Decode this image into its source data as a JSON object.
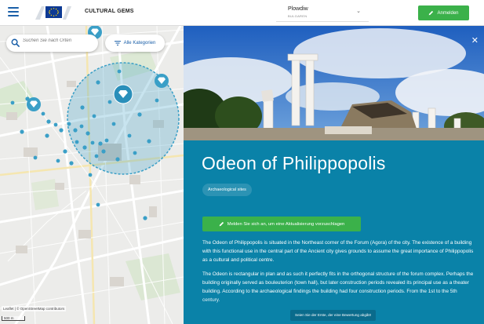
{
  "header": {
    "app_title": "CULTURAL GEMS",
    "city": {
      "name": "Plowdiw",
      "country": "BULGAREN"
    },
    "login_label": "Anmelden",
    "icons": {
      "menu": "hamburger-icon",
      "logo": "eu-flag-logo",
      "chevron": "chevron-down-icon",
      "login": "pencil-icon"
    }
  },
  "map": {
    "search": {
      "placeholder": "Suchen Sie nach Orten"
    },
    "category_button": "Alle Kategorien",
    "attribution": "Leaflet | © OpenStreetMap contributors",
    "scale": "500 m",
    "marker_color": "#3a9fc7",
    "selection_circle_color": "#3a9fc7"
  },
  "detail": {
    "title": "Odeon of Philippopolis",
    "category_tag": "Archaeological sites",
    "update_button": "Melden Sie sich an, um eine Aktualisierung vorzuschlagen",
    "paragraphs": [
      "The Odeon of Philippopolis is situated in the Northeast corner of the Forum (Agora) of the city. The existence of a building with this functional use in the central part of the Ancient city gives grounds to assume the great importance of Philippopolis as a cultural and political centre.",
      "The Odeon is rectangular in plan and as such it perfectly fits in the orthogonal structure of the forum complex. Perhaps the building originally served as bouleuterion (town hall), but later construction periods revealed its principal use as a theater building. According to the archaeological findings the building had four construction periods. From the 1st to the 5th century."
    ],
    "rating_prompt": "Seien Sie der Erste, der eine Bewertung abgibt!",
    "panel_color": "#0a82a8",
    "accent_green": "#3bb14a"
  }
}
